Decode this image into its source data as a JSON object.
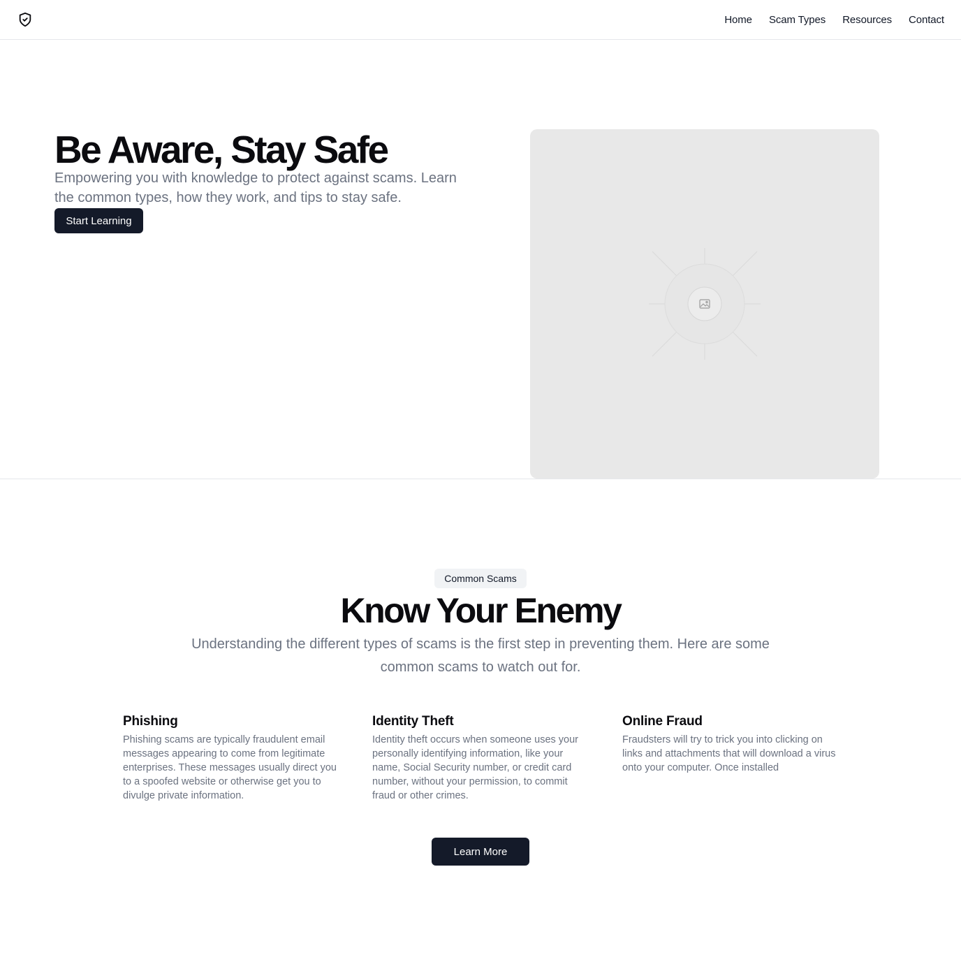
{
  "header": {
    "logo_icon": "shield-check-icon",
    "nav": [
      {
        "label": "Home"
      },
      {
        "label": "Scam Types"
      },
      {
        "label": "Resources"
      },
      {
        "label": "Contact"
      }
    ]
  },
  "hero": {
    "title": "Be Aware, Stay Safe",
    "subtitle": "Empowering you with knowledge to protect against scams. Learn the common types, how they work, and tips to stay safe.",
    "cta_label": "Start Learning",
    "image_icon": "image-placeholder-icon"
  },
  "scams": {
    "badge": "Common Scams",
    "title": "Know Your Enemy",
    "subtitle": "Understanding the different types of scams is the first step in preventing them. Here are some common scams to watch out for.",
    "cards": [
      {
        "title": "Phishing",
        "body": "Phishing scams are typically fraudulent email messages appearing to come from legitimate enterprises. These messages usually direct you to a spoofed website or otherwise get you to divulge private information."
      },
      {
        "title": "Identity Theft",
        "body": "Identity theft occurs when someone uses your personally identifying information, like your name, Social Security number, or credit card number, without your permission, to commit fraud or other crimes."
      },
      {
        "title": "Online Fraud",
        "body": "Fraudsters will try to trick you into clicking on links and attachments that will download a virus onto your computer. Once installed"
      }
    ],
    "cta_label": "Learn More"
  },
  "colors": {
    "button_bg": "#141a29",
    "muted_text": "#6b7280",
    "border": "#e5e7eb",
    "placeholder_bg": "#e8e8e8"
  }
}
